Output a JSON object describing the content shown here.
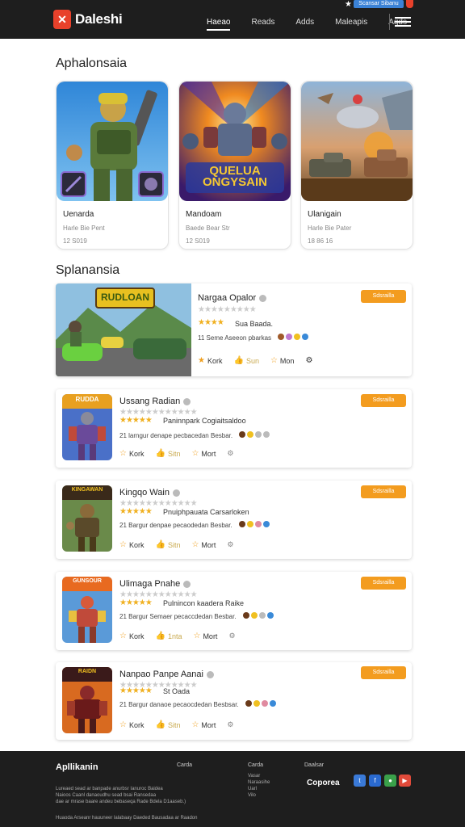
{
  "header": {
    "logo_mark": "✕",
    "brand": "Daleshi",
    "nav": [
      "Haeao",
      "Reads",
      "Adds",
      "Maleapis",
      "Aqds"
    ],
    "top_pill": "Scansar Sibanu"
  },
  "featured": {
    "title": "Aphalonsaia",
    "cards": [
      {
        "title": "Uenarda",
        "subtitle": "Harle Bie Pent",
        "meta": "12 S019"
      },
      {
        "title": "Mandoam",
        "subtitle": "Baede Bear Str",
        "meta": "12 S019"
      },
      {
        "title": "Ulanigain",
        "subtitle": "Harle Bie Pater",
        "meta": "18 86 16"
      }
    ],
    "card2_art_text": [
      "QUELUA",
      "ONGYSAIN"
    ]
  },
  "list_section": {
    "title": "Splanansia",
    "items": [
      {
        "title": "Nargaa Opalor",
        "rating": "3",
        "rating_label": "Sua Baada.",
        "desc": "11 Seme Aseeon pbarkas",
        "action1": "Kork",
        "action2": "Sun",
        "action3": "Mon",
        "badge": "Sdsrailla",
        "art_text": "RUDLOAN"
      },
      {
        "title": "Ussang Radian",
        "rating": "5",
        "rating_label": "Paninnpark Cogiaitsaldoo",
        "desc": "21 larngur denape pecbacedan Besbar.",
        "action1": "Kork",
        "action2": "Sitn",
        "action3": "Mort",
        "badge": "Sdsrailla",
        "art_text": "RUDDA"
      },
      {
        "title": "Kingqo Wain",
        "rating": "5",
        "rating_label": "Pnuiphpauata Carsarloken",
        "desc": "21 Bargur denpae pecaodedan Besbar.",
        "action1": "Kork",
        "action2": "Sitn",
        "action3": "Mort",
        "badge": "Sdsrailla",
        "art_text": "KINGAWAN"
      },
      {
        "title": "Ulimaga Pnahe",
        "rating": "5",
        "rating_label": "Pulnincon kaadera Raike",
        "desc": "21 Bargur Semaer pecaccdedan Besbar.",
        "action1": "Kork",
        "action2": "1nta",
        "action3": "Mort",
        "badge": "Sdsrailla",
        "art_text": "GUNSOUR"
      },
      {
        "title": "Nanpao Panpe Aanai",
        "rating": "5",
        "rating_label": "St Oada",
        "desc": "21 Bargur danaoe pecaocdedan Besbsar.",
        "action1": "Kork",
        "action2": "Sitn",
        "action3": "Mort",
        "badge": "Sdsrailla",
        "art_text": "RAIDN"
      }
    ]
  },
  "footer": {
    "brand": "Apllikanin",
    "col1": "Carda",
    "col2": "Carda",
    "col2_lines": [
      "Vasar",
      "Naraasihe",
      "Uarl",
      "Vilo"
    ],
    "col3": "Daalsar",
    "corp": "Coporea",
    "about": [
      "Lureaed sead ar banpade anurbsr Ianuroc Baidea",
      "Naioos Caanl danaoudhu sead bsai Ransedaa",
      "dae ar mrase baare andeu bebaseqa Rade Bdela D1aaseb.)"
    ],
    "copyright": "Huaoda Arseanr hauuneer lalabaay Daeded Bausadaa ar Raadon"
  },
  "colors": {
    "accent": "#f39c1f",
    "header_bg": "#1e1e1e",
    "brand_red": "#e8412b",
    "star": "#f0b020"
  }
}
